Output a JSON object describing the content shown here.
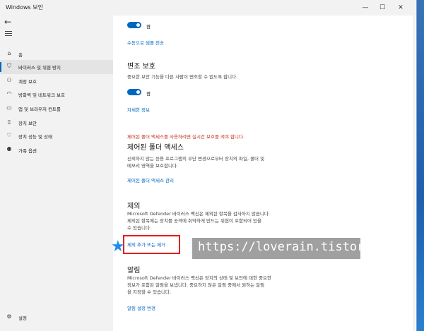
{
  "window": {
    "title": "Windows 보안",
    "minimize": "—",
    "maximize": "☐",
    "close": "✕"
  },
  "sidebar": {
    "back": "←",
    "items": [
      {
        "label": "홈",
        "icon": "⌂"
      },
      {
        "label": "바이러스 및 위협 방지",
        "icon": "⛉",
        "active": true
      },
      {
        "label": "계정 보호",
        "icon": "⚇"
      },
      {
        "label": "방화벽 및 네트워크 보호",
        "icon": "◠"
      },
      {
        "label": "앱 및 브라우저 컨트롤",
        "icon": "▭"
      },
      {
        "label": "장치 보안",
        "icon": "▯"
      },
      {
        "label": "장치 성능 및 상태",
        "icon": "♡"
      },
      {
        "label": "가족 옵션",
        "icon": "⚉"
      }
    ],
    "settings": {
      "label": "설정",
      "icon": "⚙"
    }
  },
  "content": {
    "toggle1_label": "켬",
    "manual_submit_link": "수동으로 샘플 전송",
    "tamper": {
      "title": "변조 보호",
      "desc": "중요한 보안 기능을 다른 사람이 변조할 수 없도록 합니다.",
      "toggle_label": "켬",
      "link": "자세한 정보"
    },
    "cfa": {
      "warning": "제어된 폴더 액세스를 사용하려면 실시간 보호를 켜야 합니다.",
      "title": "제어된 폴더 액세스",
      "desc1": "신뢰하지 않는 응용 프로그램의 무단 변경으로부터 장치의 파일, 폴더 및",
      "desc2": "메모리 영역을 보호합니다.",
      "link": "제어된 폴더 액세스 관리"
    },
    "exclusions": {
      "title": "제외",
      "desc1": "Microsoft Defender 바이러스 백신은 제외된 항목을 검사하지 않습니다.",
      "desc2": "제외된 항목에는 장치를 공격에 취약하게 만드는 위협이 포함되어 있을",
      "desc3": "수 있습니다.",
      "link": "제외 추가 또는 제거"
    },
    "notifications": {
      "title": "알림",
      "desc1": "Microsoft Defender 바이러스 백신은 장치의 상태 및 보안에 대한 중요한",
      "desc2": "정보가 포함된 알림을 보냅니다. 중요하지 않은 알림 중에서 원하는 알림",
      "desc3": "을 지정할 수 있습니다.",
      "link": "알림 설정 변경"
    }
  },
  "annotation": {
    "star": "★",
    "watermark": "https://loverain.tistory.com"
  }
}
